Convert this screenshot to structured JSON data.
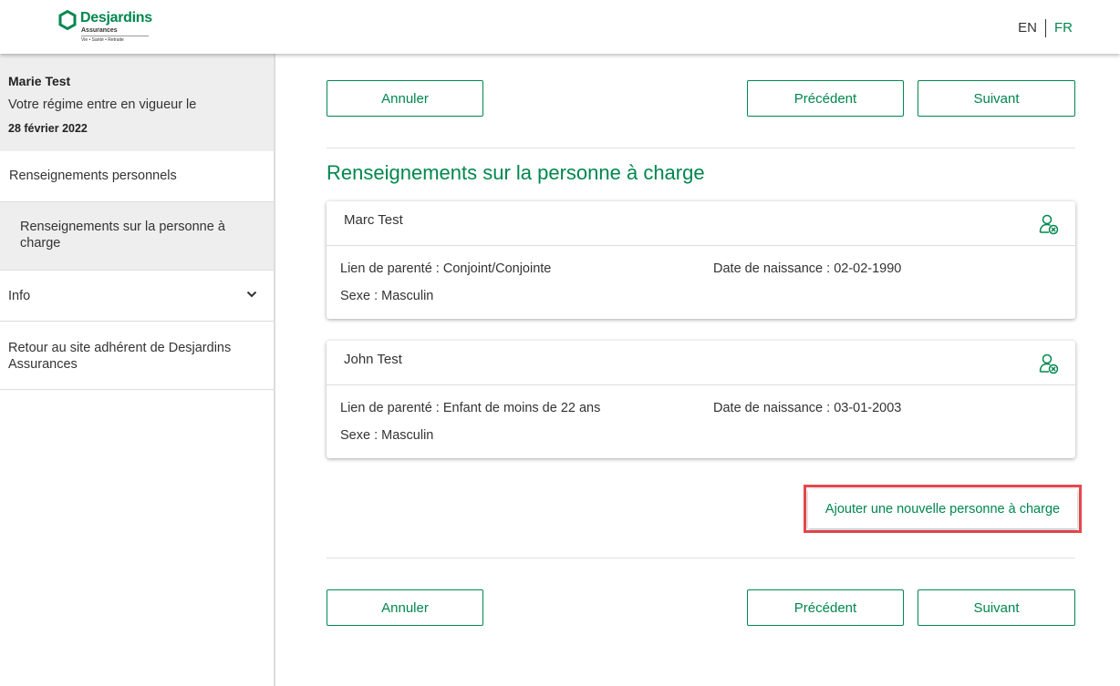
{
  "header": {
    "logo": {
      "name": "Desjardins",
      "sub": "Assurances",
      "tagline": "Vie • Santé • Retraite"
    },
    "lang_en": "EN",
    "lang_fr": "FR"
  },
  "sidebar": {
    "user_name": "Marie Test",
    "plan_text": "Votre régime entre en vigueur le",
    "plan_date": "28 février 2022",
    "items": [
      {
        "label": "Renseignements personnels"
      },
      {
        "label": "Renseignements sur la personne à charge"
      },
      {
        "label": "Info"
      },
      {
        "label": "Retour au site adhérent de Desjardins Assurances"
      }
    ]
  },
  "actions": {
    "cancel": "Annuler",
    "previous": "Précédent",
    "next": "Suivant"
  },
  "main": {
    "title": "Renseignements sur la personne à charge",
    "dependents": [
      {
        "name": "Marc Test",
        "relationship": "Lien de parenté : Conjoint/Conjointe",
        "birthdate": "Date de naissance : 02-02-1990",
        "sex": "Sexe : Masculin"
      },
      {
        "name": "John Test",
        "relationship": "Lien de parenté : Enfant de moins de 22 ans",
        "birthdate": "Date de naissance : 03-01-2003",
        "sex": "Sexe : Masculin"
      }
    ],
    "add_label": "Ajouter une nouvelle personne à charge"
  },
  "colors": {
    "brand": "#00874e",
    "highlight": "#e8484f",
    "sidebar_bg": "#eeeeee"
  }
}
